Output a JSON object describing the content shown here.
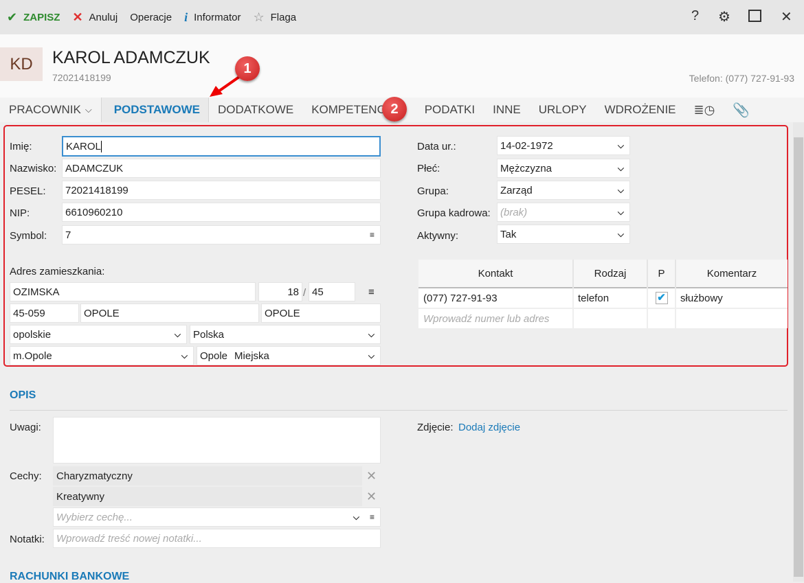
{
  "toolbar": {
    "save": "ZAPISZ",
    "cancel": "Anuluj",
    "operations": "Operacje",
    "info": "Informator",
    "flag": "Flaga"
  },
  "header": {
    "initials": "KD",
    "name": "KAROL ADAMCZUK",
    "pesel": "72021418199",
    "phone": "Telefon: (077) 727-91-93"
  },
  "tabs": {
    "menu": "PRACOWNIK",
    "items": [
      "PODSTAWOWE",
      "DODATKOWE",
      "KOMPETENCJE",
      "PODATKI",
      "INNE",
      "URLOPY",
      "WDROŻENIE"
    ]
  },
  "annotations": [
    "1",
    "2"
  ],
  "form": {
    "imie_label": "Imię:",
    "imie": "KAROL",
    "nazwisko_label": "Nazwisko:",
    "nazwisko": "ADAMCZUK",
    "pesel_label": "PESEL:",
    "pesel": "72021418199",
    "nip_label": "NIP:",
    "nip": "6610960210",
    "symbol_label": "Symbol:",
    "symbol": "7",
    "data_label": "Data ur.:",
    "data": "14-02-1972",
    "plec_label": "Płeć:",
    "plec": "Mężczyzna",
    "grupa_label": "Grupa:",
    "grupa": "Zarząd",
    "grupa_kadrowa_label": "Grupa kadrowa:",
    "grupa_kadrowa": "(brak)",
    "aktywny_label": "Aktywny:",
    "aktywny": "Tak"
  },
  "address": {
    "label": "Adres zamieszkania:",
    "street": "OZIMSKA",
    "house": "18",
    "sep": "/",
    "flat": "45",
    "postal": "45-059",
    "city": "OPOLE",
    "post": "OPOLE",
    "voivodeship": "opolskie",
    "country": "Polska",
    "county": "m.Opole",
    "commune": "Opole",
    "commune_type": "Miejska"
  },
  "contacts": {
    "headers": [
      "Kontakt",
      "Rodzaj",
      "P",
      "Komentarz"
    ],
    "rows": [
      {
        "kontakt": "(077) 727-91-93",
        "rodzaj": "telefon",
        "p": true,
        "komentarz": "służbowy"
      }
    ],
    "placeholder": "Wprowadź numer lub adres"
  },
  "opis": {
    "title": "OPIS",
    "uwagi_label": "Uwagi:",
    "uwagi": "",
    "zdjecie_label": "Zdjęcie:",
    "zdjecie_link": "Dodaj zdjęcie",
    "cechy_label": "Cechy:",
    "cechy": [
      "Charyzmatyczny",
      "Kreatywny"
    ],
    "cechy_placeholder": "Wybierz cechę...",
    "notatki_label": "Notatki:",
    "notatki_placeholder": "Wprowadź treść nowej notatki..."
  },
  "bank": {
    "title": "RACHUNKI BANKOWE"
  },
  "colors": {
    "accent": "#1a7ab8",
    "save": "#2e8b2e",
    "cancel": "#e03030",
    "highlight": "#e0202a"
  }
}
